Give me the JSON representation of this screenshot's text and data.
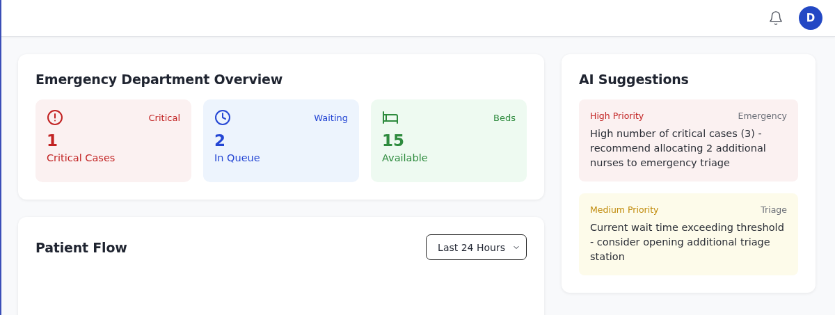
{
  "header": {
    "avatar": "D"
  },
  "overview": {
    "title": "Emergency Department Overview",
    "stats": [
      {
        "kind": "critical",
        "tag": "Critical",
        "value": "1",
        "label": "Critical Cases"
      },
      {
        "kind": "waiting",
        "tag": "Waiting",
        "value": "2",
        "label": "In Queue"
      },
      {
        "kind": "beds",
        "tag": "Beds",
        "value": "15",
        "label": "Available"
      }
    ]
  },
  "patient_flow": {
    "title": "Patient Flow",
    "range_select": "Last 24 Hours"
  },
  "suggestions": {
    "title": "AI Suggestions",
    "items": [
      {
        "kind": "high",
        "priority": "High Priority",
        "category": "Emergency",
        "text": "High number of critical cases (3) - recommend allocating 2 additional nurses to emergency triage"
      },
      {
        "kind": "medium",
        "priority": "Medium Priority",
        "category": "Triage",
        "text": "Current wait time exceeding threshold - consider opening additional triage station"
      }
    ]
  }
}
